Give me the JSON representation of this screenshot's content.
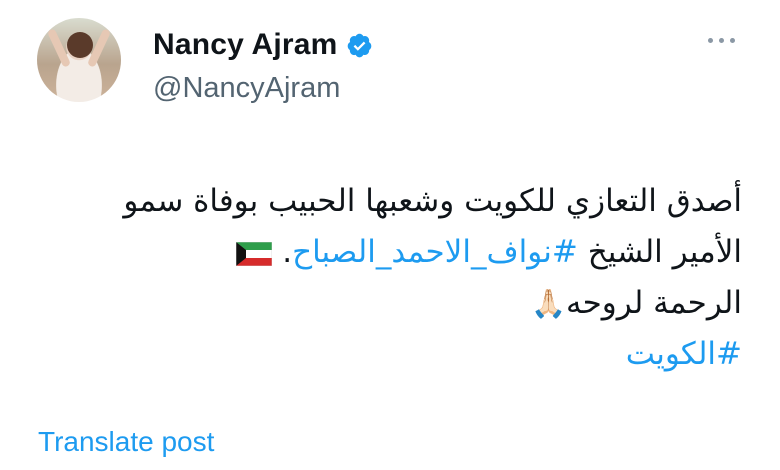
{
  "author": {
    "name": "Nancy Ajram",
    "handle": "@NancyAjram",
    "verified": true,
    "verified_color": "#1d9bf0"
  },
  "tweet": {
    "line1": "أصدق التعازي للكويت وشعبها الحبيب بوفاة سمو",
    "line2_text": "الأمير الشيخ ",
    "line2_hashtag": "#نواف_الاحمد_الصباح",
    "line2_end": ".",
    "line3_text": "الرحمة لروحه",
    "line3_emoji": "🙏🏻",
    "line4_hashtag": "#الكويت",
    "flag_emoji": "kuwait-flag",
    "hashtag_color": "#1d9bf0"
  },
  "actions": {
    "translate_label": "Translate post",
    "more_icon": "more-options-icon"
  }
}
